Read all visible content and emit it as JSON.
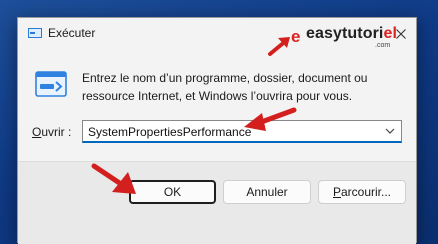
{
  "window": {
    "title": "Exécuter"
  },
  "logo": {
    "letter": "e",
    "text_main": "easytutori",
    "text_hi": "el",
    "suffix": ".com"
  },
  "description": "Entrez le nom d’un programme, dossier, document ou ressource Internet, et Windows l’ouvrira pour vous.",
  "open_field": {
    "label_underlined": "O",
    "label_rest": "uvrir :",
    "value": "SystemPropertiesPerformance"
  },
  "buttons": {
    "ok": "OK",
    "cancel": "Annuler",
    "browse_underlined": "P",
    "browse_rest": "arcourir..."
  },
  "colors": {
    "accent": "#0067c0",
    "arrow": "#d41f1f",
    "desktop": "#123f8a"
  }
}
